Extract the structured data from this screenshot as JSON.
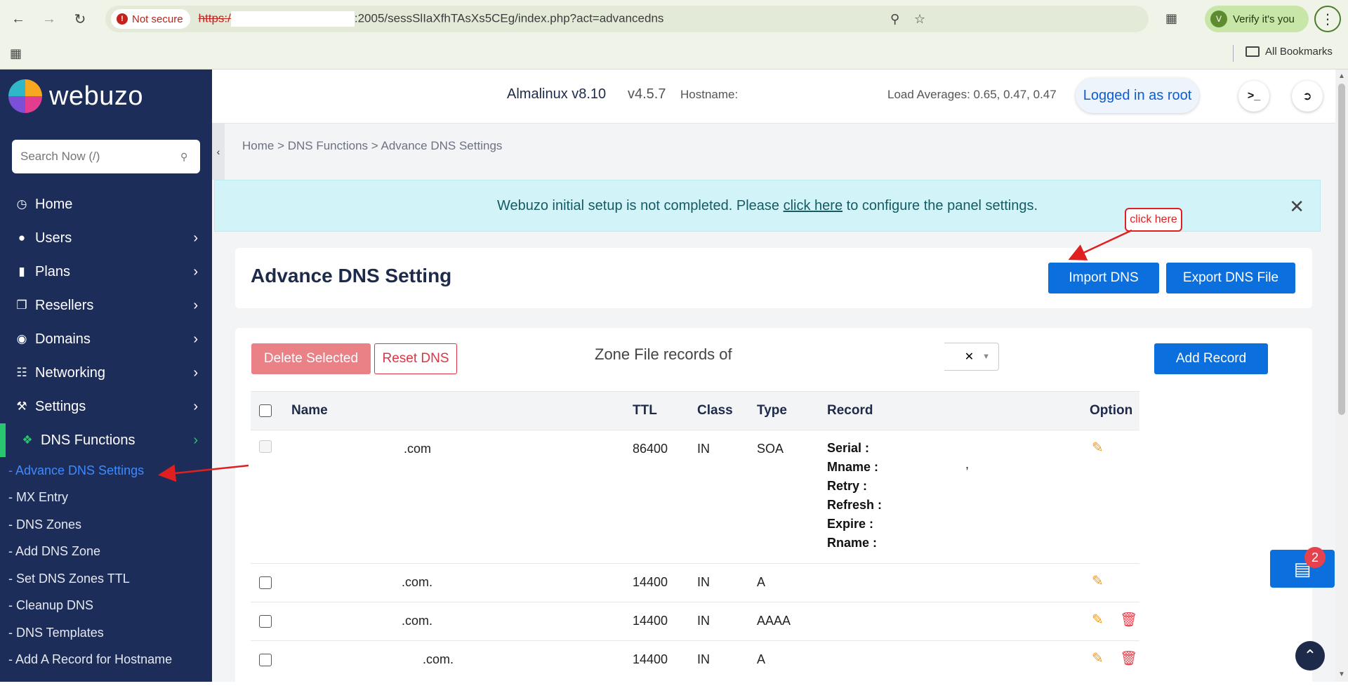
{
  "browser": {
    "not_secure": "Not secure",
    "url_scheme": "https:/",
    "url_rest": ":2005/sessSlIaXfhTAsXs5CEg/index.php?act=advancedns",
    "verify": "Verify it's you",
    "all_bookmarks": "All Bookmarks"
  },
  "sidebar": {
    "logo": "webuzo",
    "search_placeholder": "Search Now (/)",
    "menu": [
      {
        "label": "Home",
        "icon": "dashboard-icon"
      },
      {
        "label": "Users",
        "icon": "user-icon"
      },
      {
        "label": "Plans",
        "icon": "book-icon"
      },
      {
        "label": "Resellers",
        "icon": "resellers-icon"
      },
      {
        "label": "Domains",
        "icon": "globe-icon"
      },
      {
        "label": "Networking",
        "icon": "network-icon"
      },
      {
        "label": "Settings",
        "icon": "wrench-icon"
      },
      {
        "label": "DNS Functions",
        "icon": "dns-icon"
      }
    ],
    "submenu": [
      "- Advance DNS Settings",
      "- MX Entry",
      "- DNS Zones",
      "- Add DNS Zone",
      "- Set DNS Zones TTL",
      "- Cleanup DNS",
      "- DNS Templates",
      "- Add A Record for Hostname"
    ]
  },
  "header": {
    "os_name": "Almalinux v8.10",
    "version": "v4.5.7",
    "hostname": "Hostname:",
    "load": "Load Averages: 0.65, 0.47, 0.47",
    "logged_in": "Logged in as root"
  },
  "breadcrumb": "Home > DNS Functions > Advance DNS Settings",
  "alert": {
    "before": "Webuzo initial setup is not completed. Please ",
    "link": "click here",
    "after": " to configure the panel settings."
  },
  "title_card": {
    "title": "Advance DNS Setting",
    "import_btn": "Import DNS",
    "export_btn": "Export DNS File"
  },
  "annotation": "click here",
  "toolbar": {
    "delete_selected": "Delete Selected",
    "reset_dns": "Reset DNS",
    "zone_label": "Zone File records of",
    "add_record": "Add Record"
  },
  "table": {
    "headers": [
      "Name",
      "TTL",
      "Class",
      "Type",
      "Record",
      "Option"
    ],
    "soa_row": {
      "name": ".com",
      "ttl": "86400",
      "class": "IN",
      "type": "SOA",
      "fields": [
        "Serial :",
        "Mname :",
        "Retry :",
        "Refresh :",
        "Expire :",
        "Rname :"
      ],
      "comma": ","
    },
    "rows": [
      {
        "name": ".com.",
        "ttl": "14400",
        "class": "IN",
        "type": "A"
      },
      {
        "name": ".com.",
        "ttl": "14400",
        "class": "IN",
        "type": "AAAA"
      },
      {
        "name": ".com.",
        "ttl": "14400",
        "class": "IN",
        "type": "A"
      }
    ]
  },
  "float_badge": "2",
  "colors": {
    "sidebar_bg": "#1d2d5a",
    "primary": "#0b6fde",
    "active_green": "#28c76f",
    "annotation_red": "#e02020"
  }
}
